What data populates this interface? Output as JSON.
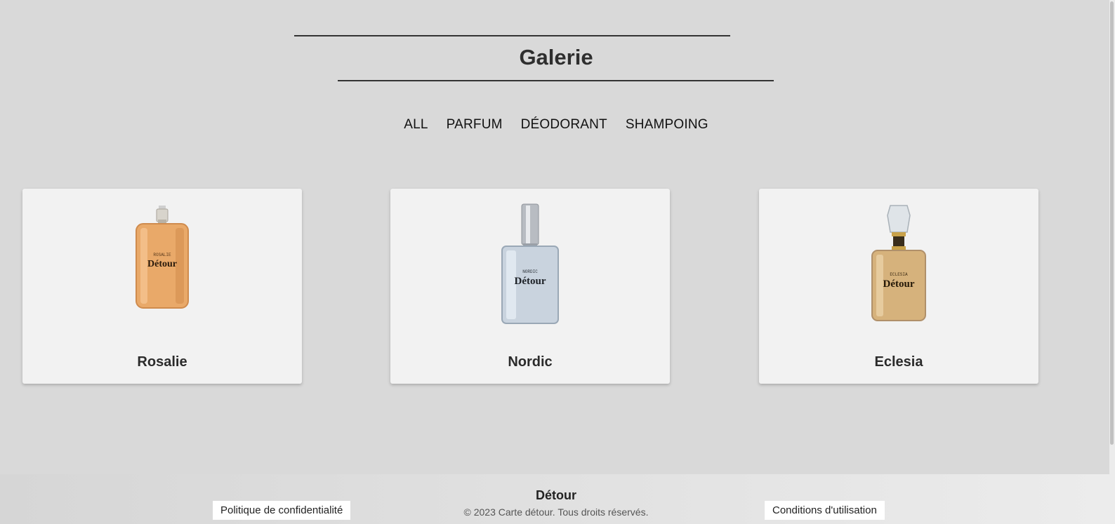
{
  "page": {
    "title": "Galerie"
  },
  "filters": [
    {
      "label": "ALL"
    },
    {
      "label": "PARFUM"
    },
    {
      "label": "DÉODORANT"
    },
    {
      "label": "SHAMPOING"
    }
  ],
  "products": [
    {
      "name": "Rosalie",
      "bottle_label": "ROSALIE",
      "brand": "Détour",
      "liquid_color": "#e9a969",
      "image": "rosalie-bottle-image"
    },
    {
      "name": "Nordic",
      "bottle_label": "NORDIC",
      "brand": "Détour",
      "liquid_color": "#c9d3de",
      "image": "nordic-bottle-image"
    },
    {
      "name": "Eclesia",
      "bottle_label": "ECLESIA",
      "brand": "Détour",
      "liquid_color": "#d6b27c",
      "image": "eclesia-bottle-image"
    }
  ],
  "footer": {
    "brand": "Détour",
    "copyright": "© 2023 Carte détour. Tous droits réservés.",
    "privacy_link": "Politique de confidentialité",
    "terms_link": "Conditions d'utilisation"
  },
  "colors": {
    "background": "#d9d9d9",
    "card": "#f2f2f2",
    "text": "#333333"
  }
}
